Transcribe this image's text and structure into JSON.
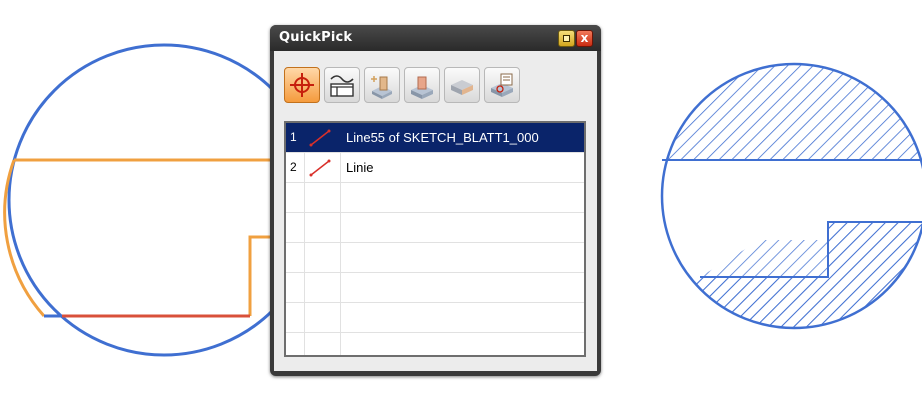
{
  "window": {
    "title": "QuickPick",
    "pin_label": "",
    "close_label": "x"
  },
  "filters": [
    {
      "name": "all-filter",
      "active": true
    },
    {
      "name": "curve-filter",
      "active": false
    },
    {
      "name": "feature-filter",
      "active": false
    },
    {
      "name": "body-filter",
      "active": false
    },
    {
      "name": "face-filter",
      "active": false
    },
    {
      "name": "datum-filter",
      "active": false
    }
  ],
  "list": {
    "rows": [
      {
        "num": "1",
        "icon": "line-icon",
        "name": "Line55 of SKETCH_BLATT1_000",
        "selected": true
      },
      {
        "num": "2",
        "icon": "line-icon",
        "name": "Linie",
        "selected": false
      }
    ]
  },
  "colors": {
    "sketch_blue": "#3f6fd1",
    "highlight_orange": "#f0a040",
    "highlight_red": "#d9503a",
    "selection": "#0a246a"
  }
}
